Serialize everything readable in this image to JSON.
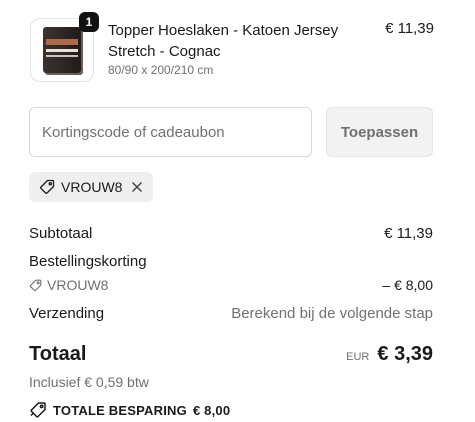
{
  "product": {
    "title": "Topper Hoeslaken - Katoen Jersey Stretch - Cognac",
    "variant": "80/90 x 200/210 cm",
    "price": "€ 11,39",
    "quantity": "1",
    "image_icon": "product-package-icon"
  },
  "discount": {
    "placeholder": "Kortingscode of cadeaubon",
    "apply_label": "Toepassen",
    "applied_code": "VROUW8"
  },
  "summary": {
    "subtotal_label": "Subtotaal",
    "subtotal_value": "€ 11,39",
    "order_discount_label": "Bestellingskorting",
    "order_discount_code": "VROUW8",
    "order_discount_value": "– € 8,00",
    "shipping_label": "Verzending",
    "shipping_value": "Berekend bij de volgende stap",
    "total_label": "Totaal",
    "currency": "EUR",
    "total_value": "€ 3,39",
    "vat_note": "Inclusief € 0,59 btw",
    "savings_label": "TOTALE BESPARING",
    "savings_value": "€ 8,00"
  },
  "icons": {
    "tag": "tag-icon",
    "close": "close-icon"
  },
  "colors": {
    "text": "#1a1a1a",
    "muted": "#707070",
    "badge": "#111111",
    "button_bg": "#f2f2f2",
    "tag_bg": "#efefef"
  }
}
